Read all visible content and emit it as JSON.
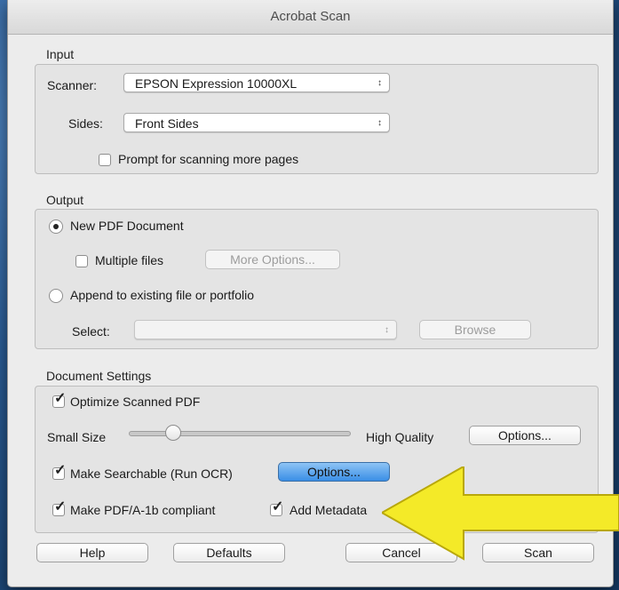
{
  "window": {
    "title": "Acrobat Scan"
  },
  "input": {
    "section_label": "Input",
    "scanner_label": "Scanner:",
    "scanner_value": "EPSON Expression 10000XL",
    "sides_label": "Sides:",
    "sides_value": "Front Sides",
    "prompt_label": "Prompt for scanning more pages",
    "prompt_checked": false
  },
  "output": {
    "section_label": "Output",
    "new_pdf_label": "New PDF Document",
    "new_pdf_selected": true,
    "multiple_files_label": "Multiple files",
    "multiple_files_checked": false,
    "more_options_label": "More Options...",
    "append_label": "Append to existing file or portfolio",
    "append_selected": false,
    "select_label": "Select:",
    "select_value": "",
    "browse_label": "Browse"
  },
  "document_settings": {
    "section_label": "Document Settings",
    "optimize_label": "Optimize Scanned PDF",
    "optimize_checked": true,
    "small_size_label": "Small Size",
    "high_quality_label": "High Quality",
    "quality_level": 0.2,
    "optimize_options_label": "Options...",
    "searchable_label": "Make Searchable (Run OCR)",
    "searchable_checked": true,
    "ocr_options_label": "Options...",
    "pdfa_label": "Make PDF/A-1b compliant",
    "pdfa_checked": true,
    "metadata_label": "Add Metadata",
    "metadata_checked": true
  },
  "footer": {
    "help_label": "Help",
    "defaults_label": "Defaults",
    "cancel_label": "Cancel",
    "scan_label": "Scan"
  },
  "colors": {
    "highlight_arrow": "#f4ea28",
    "primary_button": "#3a8ee6"
  }
}
